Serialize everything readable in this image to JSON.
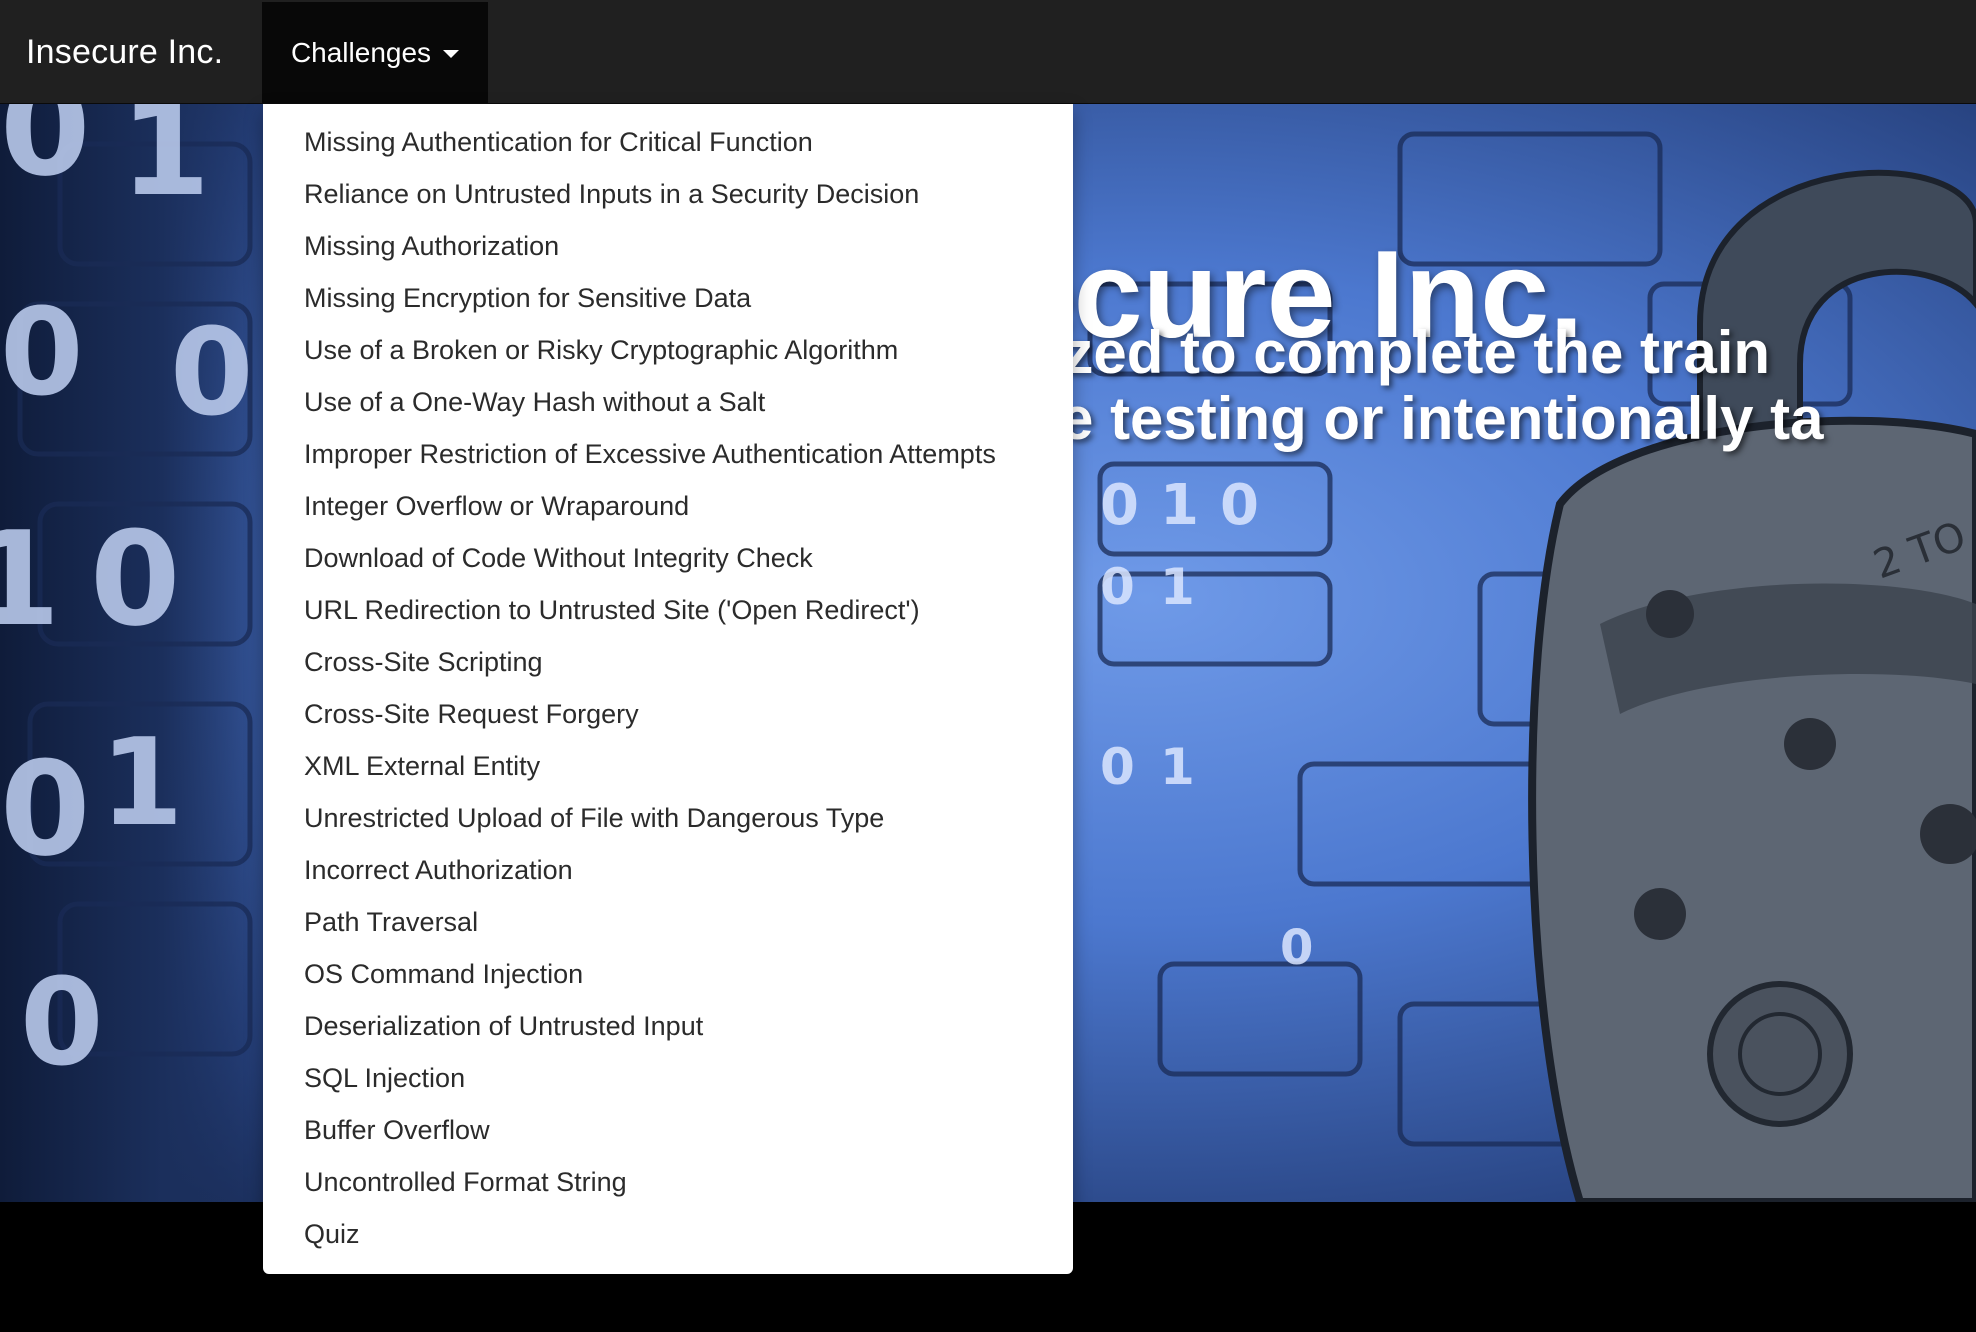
{
  "navbar": {
    "brand": "Insecure Inc.",
    "dropdown_label": "Challenges"
  },
  "dropdown": {
    "items": [
      "Missing Authentication for Critical Function",
      "Reliance on Untrusted Inputs in a Security Decision",
      "Missing Authorization",
      "Missing Encryption for Sensitive Data",
      "Use of a Broken or Risky Cryptographic Algorithm",
      "Use of a One-Way Hash without a Salt",
      "Improper Restriction of Excessive Authentication Attempts",
      "Integer Overflow or Wraparound",
      "Download of Code Without Integrity Check",
      "URL Redirection to Untrusted Site ('Open Redirect')",
      "Cross-Site Scripting",
      "Cross-Site Request Forgery",
      "XML External Entity",
      "Unrestricted Upload of File with Dangerous Type",
      "Incorrect Authorization",
      "Path Traversal",
      "OS Command Injection",
      "Deserialization of Untrusted Input",
      "SQL Injection",
      "Buffer Overflow",
      "Uncontrolled Format String",
      "Quiz"
    ]
  },
  "hero": {
    "title": "nsecure Inc.",
    "line1": "authorized to complete the train",
    "line2": "sruptive testing or intentionally ta",
    "digits": [
      "0",
      "1",
      "0",
      "0",
      "1",
      "0",
      "0",
      "1",
      "0",
      "0",
      "1",
      "0",
      "0",
      "1",
      "0",
      "1",
      "0"
    ]
  },
  "colors": {
    "navbar": "#202020",
    "navbar_active": "#080808",
    "hero_blue": "#4c78cf",
    "dropdown_text": "#2b2b2b"
  }
}
